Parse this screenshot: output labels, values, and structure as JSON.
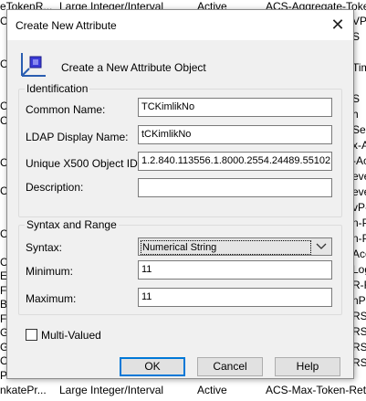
{
  "background": {
    "top_row": [
      "eTokenR...",
      "Large Integer/Interval",
      "Active",
      "ACS-Aggregate-Toke"
    ],
    "bottom_row": [
      "nkatePr...",
      "Large Integer/Interval",
      "Active",
      "ACS-Max-Token-Retr"
    ],
    "left_edge": [
      "C",
      "",
      "",
      "C",
      "",
      "",
      "C",
      "C",
      "",
      "",
      "C",
      "",
      "C",
      "",
      "",
      "C",
      "",
      "C",
      "Ex",
      "FL",
      "Ba",
      "Fi",
      "Gl",
      "Gl",
      "Of",
      "Pr"
    ],
    "right_edge": [
      "VP-",
      "S",
      "",
      "Tim",
      "",
      "S",
      "h",
      "Ser",
      "x-Ac",
      "-Act",
      "eve",
      "eve",
      "vP-",
      "n-P",
      "n-Pc",
      "Acc",
      "Log",
      "R-R",
      "nP-R",
      "RST",
      "RST",
      "RST",
      "RST"
    ]
  },
  "dialog": {
    "title": "Create New Attribute",
    "close_glyph": "✕",
    "heading": "Create a New Attribute Object",
    "identification": {
      "title": "Identification",
      "common_name_label": "Common Name:",
      "common_name_value": "TCKimlikNo",
      "ldap_label": "LDAP Display Name:",
      "ldap_value": "tCKimlikNo",
      "oid_label": "Unique X500 Object ID:",
      "oid_value": "1.2.840.113556.1.8000.2554.24489.55102.",
      "description_label": "Description:",
      "description_value": ""
    },
    "syntax": {
      "title": "Syntax and Range",
      "syntax_label": "Syntax:",
      "syntax_value": "Numerical String",
      "minimum_label": "Minimum:",
      "minimum_value": "11",
      "maximum_label": "Maximum:",
      "maximum_value": "11"
    },
    "multi_valued_label": "Multi-Valued",
    "multi_valued_checked": false,
    "buttons": {
      "ok": "OK",
      "cancel": "Cancel",
      "help": "Help"
    }
  }
}
